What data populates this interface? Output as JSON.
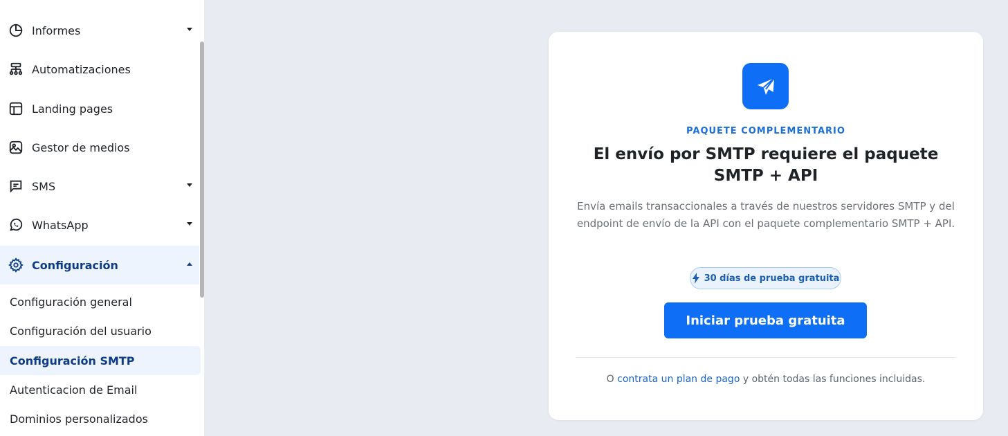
{
  "sidebar": {
    "items": [
      {
        "label": "Informes",
        "icon": "chart-pie-icon",
        "has_caret": true
      },
      {
        "label": "Automatizaciones",
        "icon": "flow-tree-icon",
        "has_caret": false
      },
      {
        "label": "Landing pages",
        "icon": "layout-icon",
        "has_caret": false
      },
      {
        "label": "Gestor de medios",
        "icon": "image-icon",
        "has_caret": false
      },
      {
        "label": "SMS",
        "icon": "message-icon",
        "has_caret": true
      },
      {
        "label": "WhatsApp",
        "icon": "whatsapp-icon",
        "has_caret": true
      },
      {
        "label": "Configuración",
        "icon": "gear-icon",
        "has_caret": true,
        "expanded": true
      }
    ],
    "sub_items": [
      {
        "label": "Configuración general"
      },
      {
        "label": "Configuración del usuario"
      },
      {
        "label": "Configuración SMTP",
        "current": true
      },
      {
        "label": "Autenticacion de Email"
      },
      {
        "label": "Dominios personalizados"
      }
    ]
  },
  "card": {
    "icon": "paper-plane-icon",
    "eyebrow": "PAQUETE COMPLEMENTARIO",
    "title": "El envío por SMTP requiere el paquete SMTP + API",
    "description": "Envía emails transaccionales a través de nuestros servidores SMTP y del endpoint de envío de la API con el paquete complementario SMTP + API.",
    "trial_badge": "30 días de prueba gratuita",
    "cta_label": "Iniciar prueba gratuita",
    "footer_prefix": "O ",
    "footer_link": "contrata un plan de pago",
    "footer_suffix": " y obtén todas las funciones incluidas."
  },
  "colors": {
    "accent": "#0e6ef5",
    "active_text": "#0e3b85",
    "active_bg": "#edf4fd",
    "page_bg": "#e8ebf2"
  }
}
